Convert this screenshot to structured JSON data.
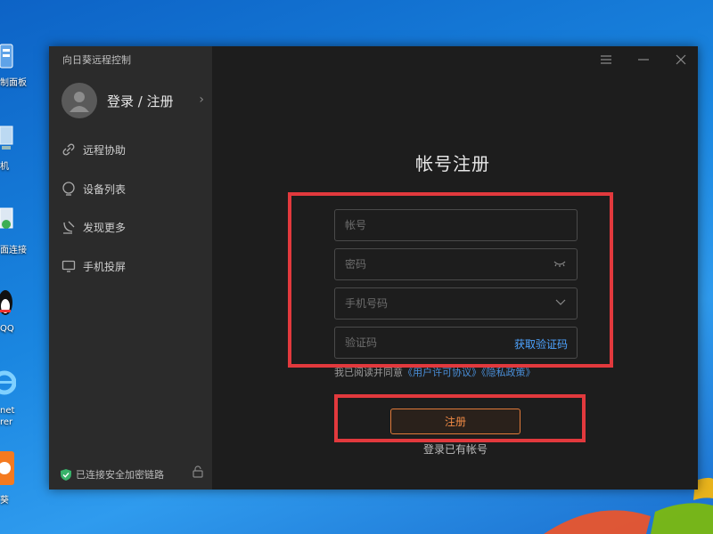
{
  "desktop": {
    "icons": [
      {
        "name": "control-panel",
        "label": "制面板"
      },
      {
        "name": "computer",
        "label": "机"
      },
      {
        "name": "remote-desktop",
        "label": "面连接"
      },
      {
        "name": "qq",
        "label": "QQ"
      },
      {
        "name": "internet-explorer",
        "label_line1": "net",
        "label_line2": "rer"
      },
      {
        "name": "sunlogin",
        "label": "葵"
      }
    ]
  },
  "app": {
    "title": "向日葵远程控制",
    "user": {
      "label": "登录 / 注册"
    },
    "nav": [
      {
        "key": "remote",
        "label": "远程协助",
        "icon": "link-icon"
      },
      {
        "key": "devices",
        "label": "设备列表",
        "icon": "device-list-icon"
      },
      {
        "key": "discover",
        "label": "发现更多",
        "icon": "discover-icon"
      },
      {
        "key": "mirror",
        "label": "手机投屏",
        "icon": "screen-cast-icon"
      }
    ],
    "secure_status": "已连接安全加密链路",
    "colors": {
      "accent": "#e07a3a",
      "link": "#4da3ff",
      "highlight": "#e2393d"
    }
  },
  "form": {
    "title": "帐号注册",
    "account_placeholder": "帐号",
    "password_placeholder": "密码",
    "phone_placeholder": "手机号码",
    "code_placeholder": "验证码",
    "get_code": "获取验证码",
    "agreement_prefix": "我已阅读并同意",
    "user_agreement": "《用户许可协议》",
    "privacy_policy": "《隐私政策》",
    "register_button": "注册",
    "login_link": "登录已有帐号"
  }
}
